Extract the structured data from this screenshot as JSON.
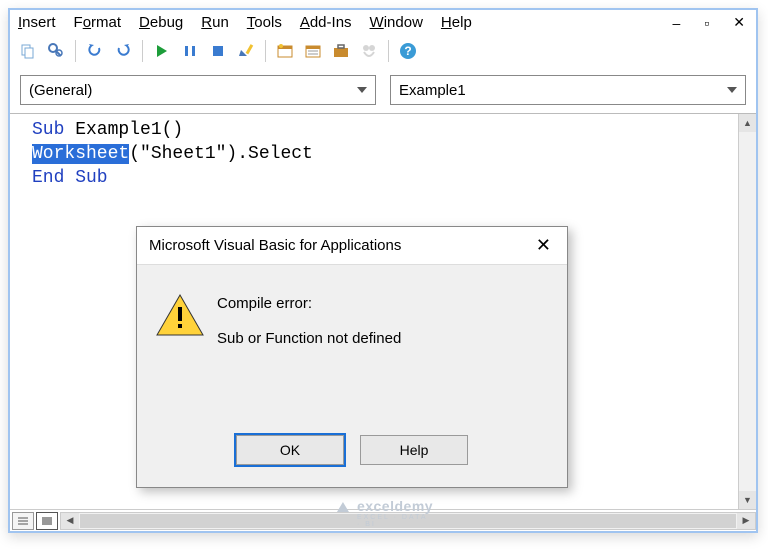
{
  "menu": {
    "items": [
      {
        "pre": "",
        "u": "I",
        "post": "nsert"
      },
      {
        "pre": "F",
        "u": "o",
        "post": "rmat"
      },
      {
        "pre": "",
        "u": "D",
        "post": "ebug"
      },
      {
        "pre": "",
        "u": "R",
        "post": "un"
      },
      {
        "pre": "",
        "u": "T",
        "post": "ools"
      },
      {
        "pre": "",
        "u": "A",
        "post": "dd-Ins"
      },
      {
        "pre": "",
        "u": "W",
        "post": "indow"
      },
      {
        "pre": "",
        "u": "H",
        "post": "elp"
      }
    ]
  },
  "dropdowns": {
    "object": "(General)",
    "procedure": "Example1"
  },
  "code": {
    "l1_kw": "Sub",
    "l1_rest": " Example1()",
    "l2_hl": "Worksheet",
    "l2_rest": "(\"Sheet1\").Select",
    "l3": "End Sub"
  },
  "dialog": {
    "title": "Microsoft Visual Basic for Applications",
    "line1": "Compile error:",
    "line2": "Sub or Function not defined",
    "ok": "OK",
    "help": "Help"
  },
  "watermark": {
    "brand": "exceldemy",
    "sub": "EXCEL · DATA · BI"
  }
}
